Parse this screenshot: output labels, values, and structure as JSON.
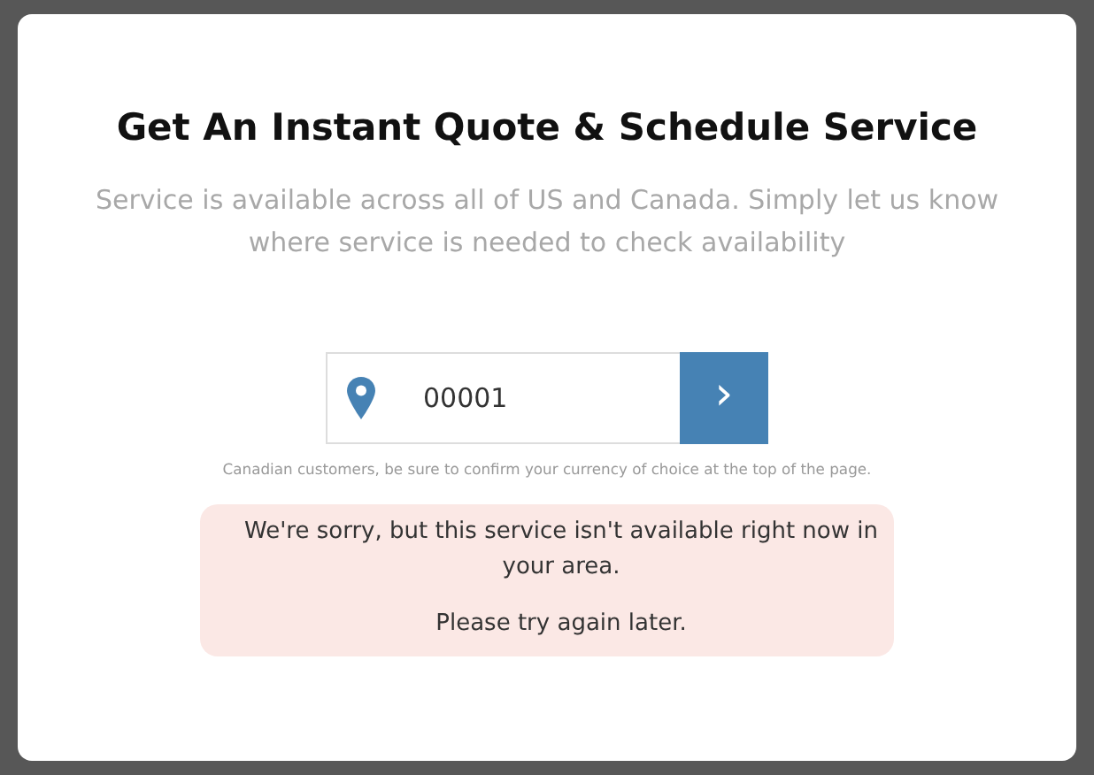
{
  "modal": {
    "title": "Get An Instant Quote & Schedule Service",
    "subtitle": "Service is available across all of US and Canada. Simply let us know where service is needed to check availability",
    "zip_field": {
      "value": "00001"
    },
    "submit_button": {
      "label": "›"
    },
    "note": "Canadian customers, be sure to confirm your currency of choice at the top of the page.",
    "alert": {
      "messages": [
        "We're sorry, but this service isn't available right now in your area.",
        "Please try again later."
      ]
    }
  }
}
